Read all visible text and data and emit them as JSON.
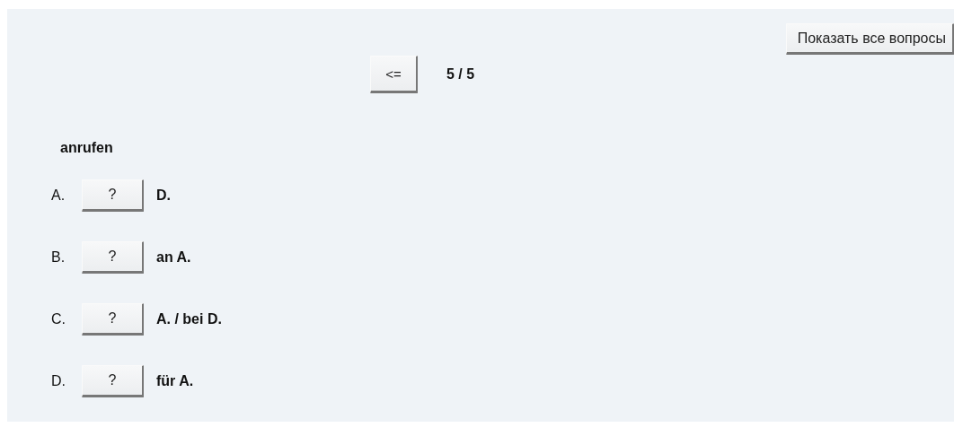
{
  "show_all_button": "Показать все вопросы",
  "navigation": {
    "back_button": "<=",
    "counter": "5 / 5"
  },
  "question": {
    "word": "anrufen",
    "options": [
      {
        "letter": "A.",
        "answer_button": "?",
        "text": "D."
      },
      {
        "letter": "B.",
        "answer_button": "?",
        "text": "an A."
      },
      {
        "letter": "C.",
        "answer_button": "?",
        "text": "A. / bei D."
      },
      {
        "letter": "D.",
        "answer_button": "?",
        "text": "für A."
      }
    ]
  }
}
